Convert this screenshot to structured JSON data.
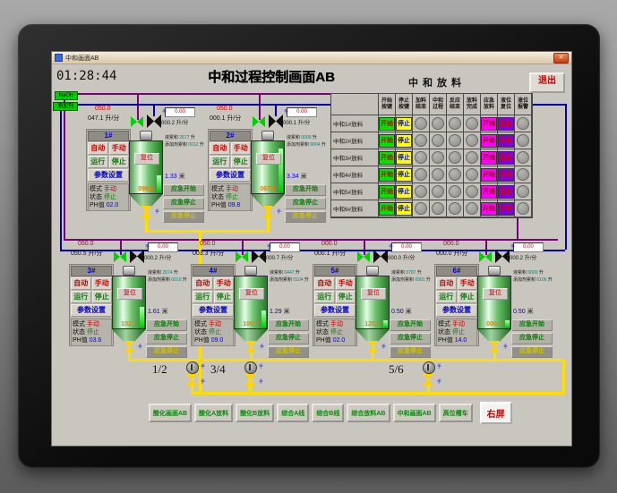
{
  "window": {
    "title": "中和画面AB",
    "close": "✕"
  },
  "header": {
    "clock": "01:28:44",
    "title": "中和过程控制画面AB",
    "panel_title": "中和放料",
    "exit": "退出"
  },
  "sources": {
    "naoh": "NaOH",
    "additive": "添加剂"
  },
  "labels": {
    "auto": "自动",
    "manual": "手动",
    "run": "运行",
    "stop": "停止",
    "params": "参数设置",
    "mode": "模式",
    "state": "状态",
    "ph": "PH值",
    "flow_unit": "升/分",
    "acc": "液累积",
    "add_acc": "添加剂累积",
    "vol_unit": "升",
    "em_start": "应急开始",
    "em_stop": "应急停止",
    "em_stop2": "应急停止",
    "tank_btn": "复位",
    "valve_tag": "手"
  },
  "units": [
    {
      "id": "1#",
      "set": "050.0",
      "flow": "047.1",
      "add_set": "0.00",
      "add_flow": "000.2",
      "acc": "2677",
      "add_acc_v": "0012",
      "level": "1.33",
      "level_unit": "米",
      "level_pct": 33,
      "tank_val": "098.2",
      "mode": "手动",
      "state": "停止",
      "ph": "02.0"
    },
    {
      "id": "2#",
      "set": "050.0",
      "flow": "000.1",
      "add_set": "0.00",
      "add_flow": "000.1",
      "acc": "0000",
      "add_acc_v": "0004",
      "level": "3.34",
      "level_unit": "米",
      "level_pct": 84,
      "tank_val": "067.6",
      "mode": "手动",
      "state": "停止",
      "ph": "09.8"
    },
    {
      "id": "3#",
      "set": "050.0",
      "flow": "050.5",
      "add_set": "0.00",
      "add_flow": "000.2",
      "acc": "2974",
      "add_acc_v": "0010",
      "level": "1.61",
      "level_unit": "米",
      "level_pct": 40,
      "tank_val": "102.7",
      "mode": "手动",
      "state": "停止",
      "ph": "03.6"
    },
    {
      "id": "4#",
      "set": "050.0",
      "flow": "003.3",
      "add_set": "0.00",
      "add_flow": "000.7",
      "acc": "0447",
      "add_acc_v": "0104",
      "level": "1.29",
      "level_unit": "米",
      "level_pct": 32,
      "tank_val": "100.0",
      "mode": "手动",
      "state": "停止",
      "ph": "09.0"
    },
    {
      "id": "5#",
      "set": "000.0",
      "flow": "000.1",
      "add_set": "0.00",
      "add_flow": "000.0",
      "acc": "0787",
      "add_acc_v": "0001",
      "level": "0.50",
      "level_unit": "米",
      "level_pct": 13,
      "tank_val": "120.0",
      "mode": "手动",
      "state": "停止",
      "ph": "02.0"
    },
    {
      "id": "6#",
      "set": "000.0",
      "flow": "000.0",
      "add_set": "0.00",
      "add_flow": "000.2",
      "acc": "0000",
      "add_acc_v": "0106",
      "level": "0.50",
      "level_unit": "米",
      "level_pct": 13,
      "tank_val": "000.0",
      "mode": "手动",
      "state": "停止",
      "ph": "14.0"
    }
  ],
  "table": {
    "headers": [
      {
        "l1": "开始",
        "l2": "按键"
      },
      {
        "l1": "停止",
        "l2": "按键"
      },
      {
        "l1": "加料",
        "l2": "结束"
      },
      {
        "l1": "中和",
        "l2": "过程"
      },
      {
        "l1": "反应",
        "l2": "结束"
      },
      {
        "l1": "放料",
        "l2": "完成"
      },
      {
        "l1": "应急",
        "l2": "放料"
      },
      {
        "l1": "液位",
        "l2": "复位"
      },
      {
        "l1": "液位",
        "l2": "报警"
      }
    ],
    "rows": [
      {
        "label": "中和1#放料"
      },
      {
        "label": "中和2#放料"
      },
      {
        "label": "中和3#放料"
      },
      {
        "label": "中和4#放料"
      },
      {
        "label": "中和5#放料"
      },
      {
        "label": "中和6#放料"
      }
    ],
    "btn": {
      "start": "开始",
      "stop": "停止",
      "em": "开始",
      "reset": "复位"
    }
  },
  "pumps": [
    {
      "label": "1/2"
    },
    {
      "label": "3/4"
    },
    {
      "label": "5/6"
    }
  ],
  "nav": {
    "items": [
      "酸化画面AB",
      "酸化A放料",
      "酸化B放料",
      "综合A线",
      "综合B线",
      "综合放料AB",
      "中和画面AB",
      "高位槽车"
    ],
    "right_screen": "右屏"
  },
  "colors": {
    "naoh_pipe": "#7a007a",
    "additive_pipe": "#0000aa",
    "discharge_pipe": "#ffdf00",
    "start_green": "#00e400",
    "stop_yellow": "#ffff00",
    "em_magenta": "#ff00ff",
    "reset_purple": "#7d00e8"
  }
}
